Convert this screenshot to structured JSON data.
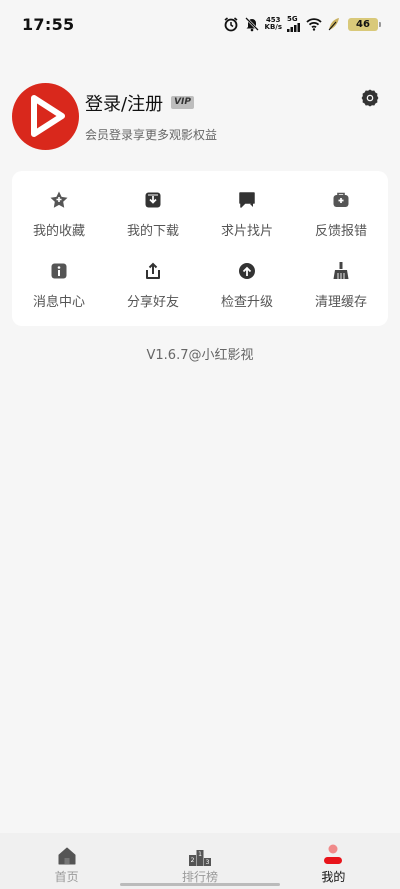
{
  "status_bar": {
    "time": "17:55",
    "net_speed_value": "453",
    "net_speed_unit": "KB/s",
    "signal_label": "5G",
    "battery_level": "46"
  },
  "profile": {
    "login_label": "登录/注册",
    "vip_badge": "VIP",
    "subtitle": "会员登录享更多观影权益"
  },
  "grid": {
    "items": [
      {
        "label": "我的收藏",
        "icon": "favorite-star-icon"
      },
      {
        "label": "我的下载",
        "icon": "download-box-icon"
      },
      {
        "label": "求片找片",
        "icon": "chat-bubble-icon"
      },
      {
        "label": "反馈报错",
        "icon": "feedback-icon"
      },
      {
        "label": "消息中心",
        "icon": "info-icon"
      },
      {
        "label": "分享好友",
        "icon": "share-icon"
      },
      {
        "label": "检查升级",
        "icon": "upgrade-icon"
      },
      {
        "label": "清理缓存",
        "icon": "broom-icon"
      }
    ]
  },
  "version": "V1.6.7@小红影视",
  "bottom_nav": {
    "items": [
      {
        "label": "首页",
        "icon": "home-icon",
        "active": false
      },
      {
        "label": "排行榜",
        "icon": "podium-icon",
        "active": false
      },
      {
        "label": "我的",
        "icon": "profile-icon",
        "active": true
      }
    ]
  },
  "colors": {
    "brand": "#d9281c",
    "background": "#f6f6f6",
    "card": "#ffffff",
    "active_nav_icon": "#e8141b"
  }
}
